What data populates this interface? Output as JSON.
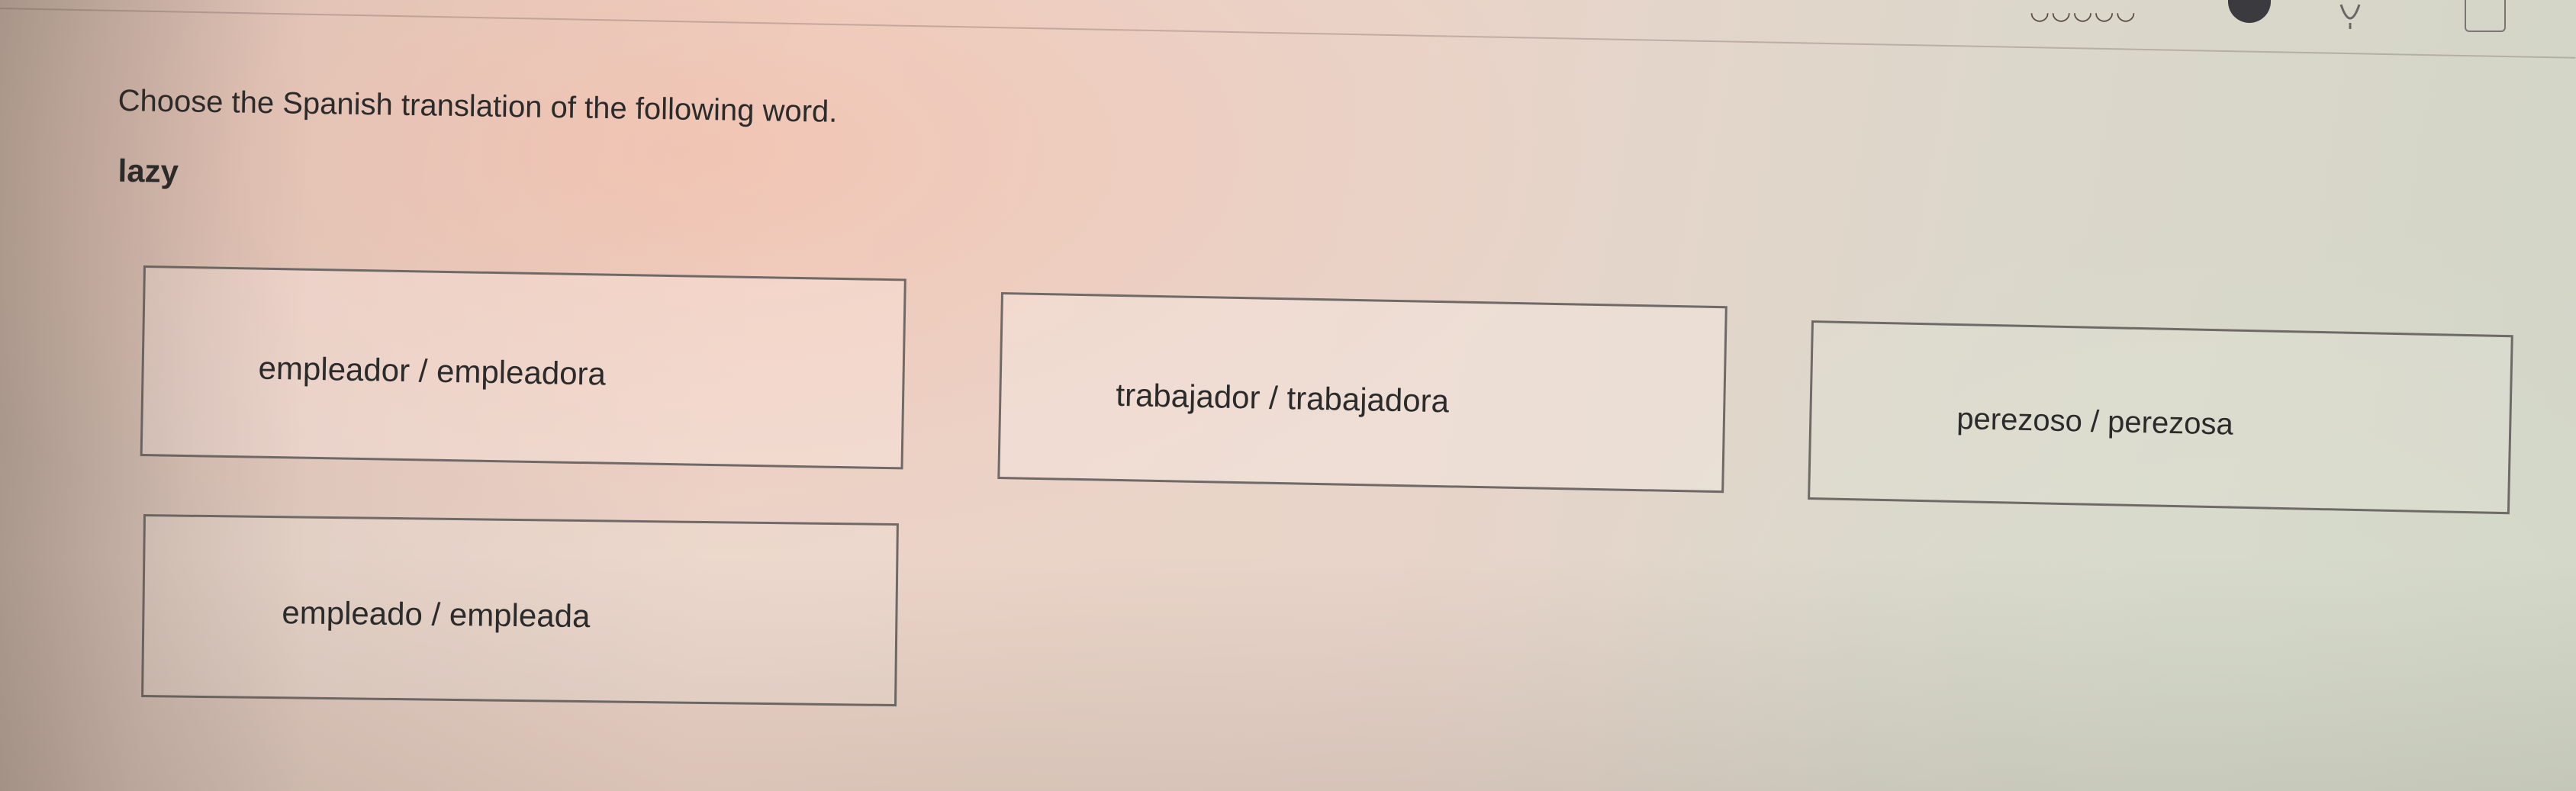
{
  "question": {
    "prompt": "Choose the Spanish translation of the following word.",
    "word": "lazy"
  },
  "options": [
    {
      "label": "empleador / empleadora"
    },
    {
      "label": "trabajador / trabajadora"
    },
    {
      "label": "perezoso / perezosa"
    },
    {
      "label": "empleado / empleada"
    }
  ],
  "toolbar": {
    "icons": [
      "timer-icon",
      "record-icon",
      "lightbulb-hint-icon",
      "expand-icon"
    ]
  },
  "colors": {
    "border": "#6f6a68",
    "text": "#2b2b2b"
  }
}
